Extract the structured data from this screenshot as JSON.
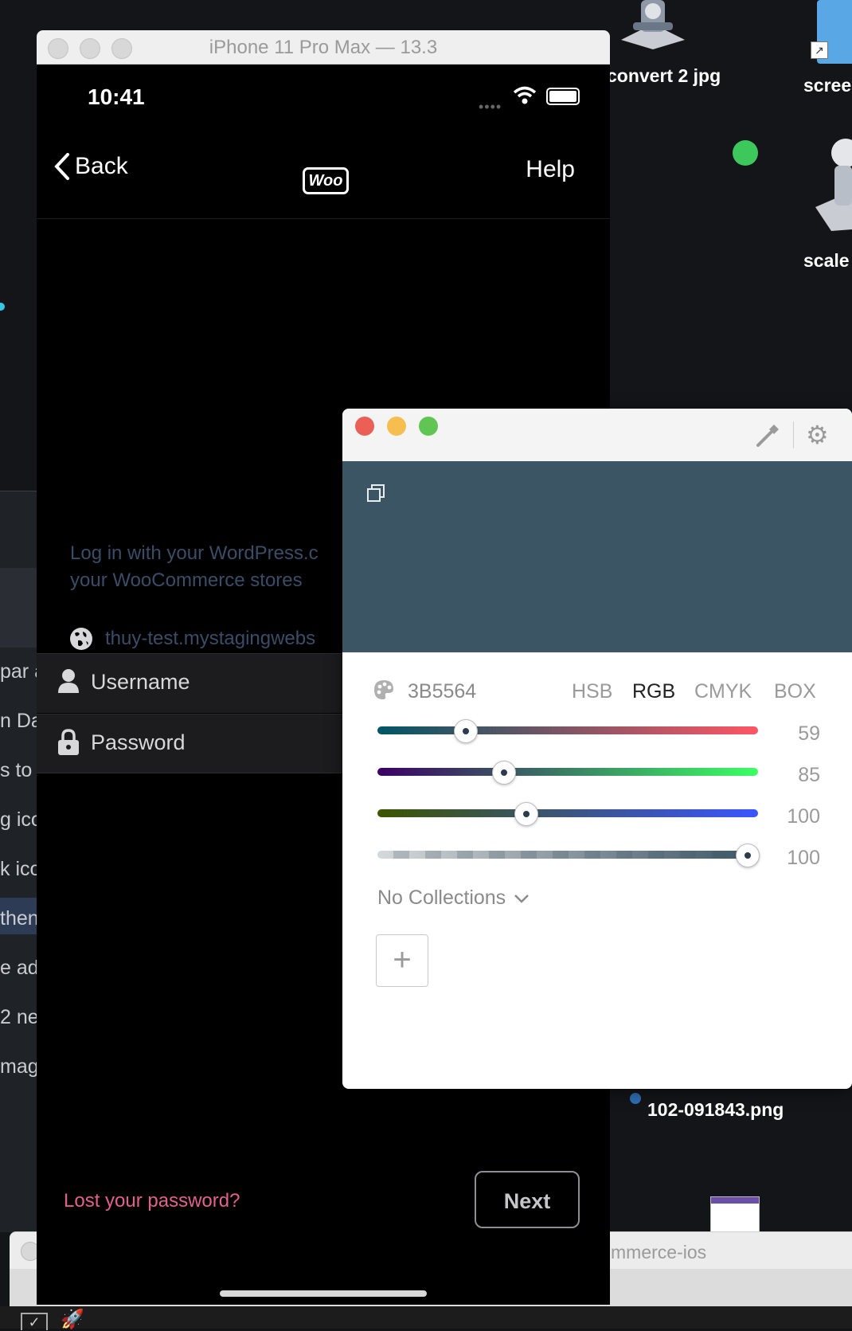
{
  "desktop": {
    "icons": [
      {
        "label": "convert 2 jpg"
      },
      {
        "label": "scree"
      },
      {
        "label": "scale"
      }
    ],
    "file_label_line2": "102-091843.png",
    "left_rows": [
      "par a",
      "n Da",
      "s to",
      "g ico",
      "k ico",
      "then",
      "e ad",
      "2 ne",
      "mag"
    ]
  },
  "simulator": {
    "title": "iPhone 11 Pro Max — 13.3",
    "status_time": "10:41",
    "nav": {
      "back_label": "Back",
      "help_label": "Help",
      "logo": "Woo"
    },
    "login_text_line1": "Log in with your WordPress.c",
    "login_text_line2": "your WooCommerce stores",
    "site_url": "thuy-test.mystagingwebs",
    "username_label": "Username",
    "password_label": "Password",
    "lost_password": "Lost your password?",
    "next_label": "Next"
  },
  "xcode_window": {
    "tab_label": "mmerce-ios"
  },
  "color_picker": {
    "hex": "3B5564",
    "swatch_color": "#3B5564",
    "modes": [
      "HSB",
      "RGB",
      "CMYK",
      "BOX"
    ],
    "active_mode": "RGB",
    "sliders": [
      {
        "channel": "red",
        "value": "59",
        "fraction": 0.23
      },
      {
        "channel": "green",
        "value": "85",
        "fraction": 0.33
      },
      {
        "channel": "blue",
        "value": "100",
        "fraction": 0.39
      },
      {
        "channel": "alpha",
        "value": "100",
        "fraction": 1.0
      }
    ],
    "collections_label": "No Collections",
    "add_symbol": "+"
  },
  "colors": {
    "accent_pink": "#E2608F",
    "traffic_red": "#EC5F57",
    "traffic_yellow": "#F5BE4F",
    "traffic_green": "#61C554",
    "status_dot": "#3CC85A"
  }
}
